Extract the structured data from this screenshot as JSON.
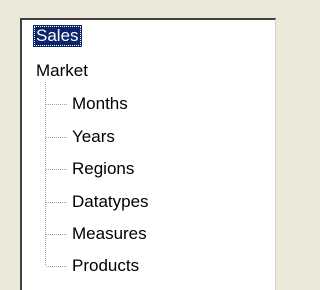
{
  "tree": {
    "roots": [
      {
        "label": "Sales",
        "selected": true
      },
      {
        "label": "Market",
        "selected": false
      }
    ],
    "market_children": [
      {
        "label": "Months"
      },
      {
        "label": "Years"
      },
      {
        "label": "Regions"
      },
      {
        "label": "Datatypes"
      },
      {
        "label": "Measures"
      },
      {
        "label": "Products"
      }
    ]
  },
  "colors": {
    "selection_background": "#0a246a",
    "selection_text": "#ffffff",
    "tree_line": "#a0a0a0",
    "panel_background": "#ffffff",
    "window_background": "#ece9d8"
  }
}
